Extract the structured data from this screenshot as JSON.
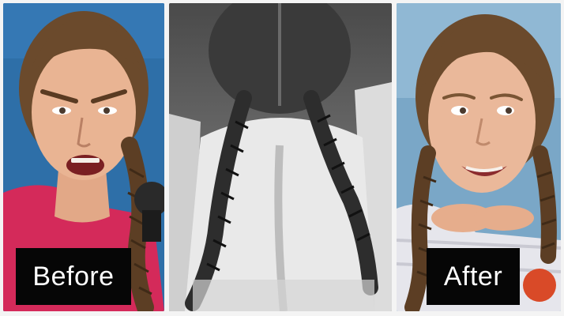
{
  "collage": {
    "panel_labels": {
      "before": "Before",
      "after": "After"
    }
  },
  "colors": {
    "left_background": "#2e6fa8",
    "middle_background": "#6a6a6a",
    "right_background": "#7aa7c7",
    "label_background": "#060606",
    "label_text": "#ffffff",
    "hair": "#6b4a2c",
    "skin": "#e9b493",
    "shirt": "#d42a5a"
  }
}
